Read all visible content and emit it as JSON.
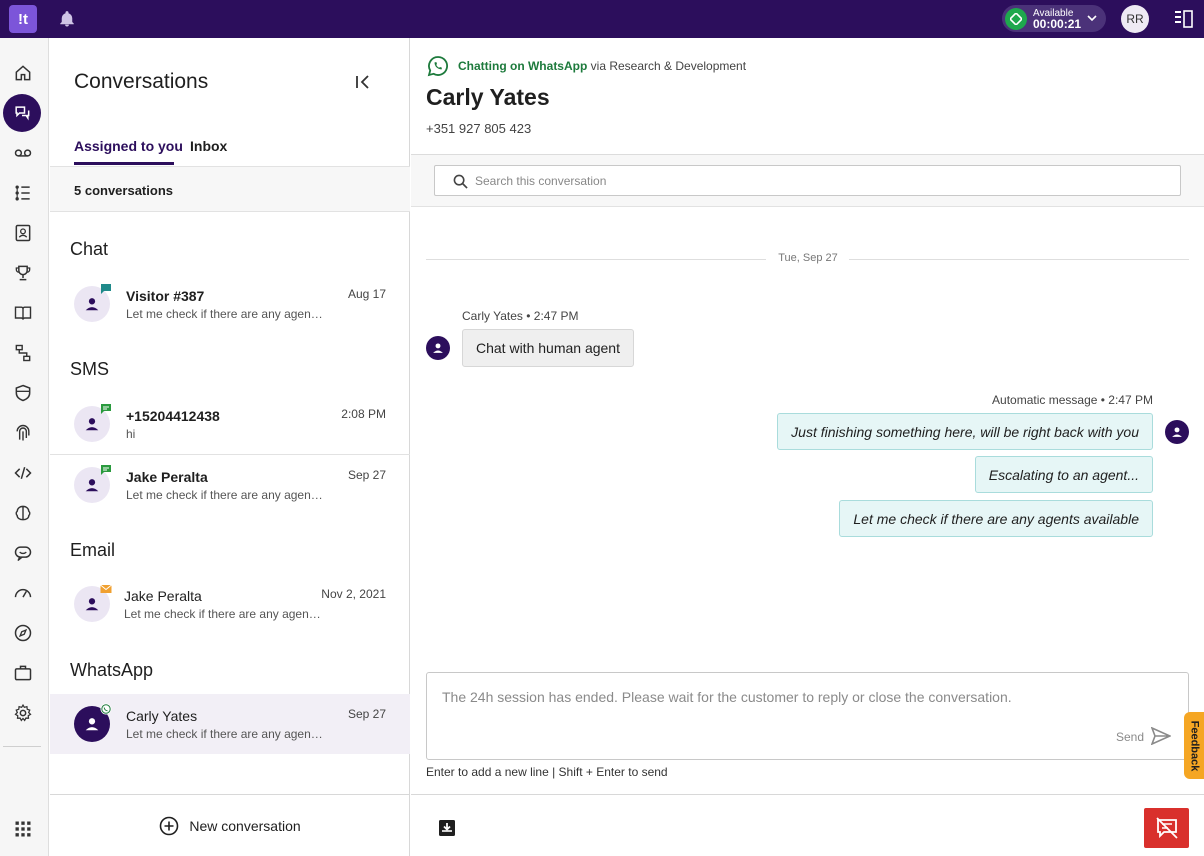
{
  "topbar": {
    "logo_text": "!t",
    "status_label": "Available",
    "status_time": "00:00:21",
    "avatar_initials": "RR"
  },
  "conversations": {
    "title": "Conversations",
    "tabs": [
      {
        "label": "Assigned to you"
      },
      {
        "label": "Inbox"
      }
    ],
    "count_text": "5 conversations",
    "sections": [
      {
        "title": "Chat",
        "items": [
          {
            "name": "Visitor #387",
            "preview": "Let me check if there are any agents available",
            "date": "Aug 17",
            "channel": "chat"
          }
        ]
      },
      {
        "title": "SMS",
        "items": [
          {
            "name": "+15204412438",
            "preview": "hi",
            "date": "2:08 PM",
            "channel": "sms"
          },
          {
            "name": "Jake Peralta",
            "preview": "Let me check if there are any agents available",
            "date": "Sep 27",
            "channel": "sms"
          }
        ]
      },
      {
        "title": "Email",
        "items": [
          {
            "name": "Jake Peralta",
            "preview": "Let me check if there are any agents available",
            "date": "Nov 2, 2021",
            "channel": "email"
          }
        ]
      },
      {
        "title": "WhatsApp",
        "items": [
          {
            "name": "Carly Yates",
            "preview": "Let me check if there are any agents available",
            "date": "Sep 27",
            "channel": "whatsapp",
            "selected": true
          }
        ]
      }
    ],
    "new_conversation_label": "New conversation"
  },
  "chat": {
    "channel_strong": "Chatting on WhatsApp",
    "channel_rest": " via Research & Development",
    "contact_name": "Carly Yates",
    "contact_phone": "+351 927 805 423",
    "search_placeholder": "Search this conversation",
    "date_separator": "Tue, Sep 27",
    "incoming_meta": "Carly Yates • 2:47 PM",
    "incoming_message": "Chat with human agent",
    "outgoing_meta": "Automatic message • 2:47 PM",
    "outgoing_messages": [
      "Just finishing something here, will be right back with you",
      "Escalating to an agent...",
      "Let me check if there are any agents available"
    ],
    "composer_text": "The 24h session has ended. Please wait for the customer to reply or close the conversation.",
    "send_label": "Send",
    "composer_hint": "Enter to add a new line | Shift + Enter to send"
  },
  "feedback_label": "Feedback",
  "colors": {
    "topbar": "#2c0e5c",
    "accent": "#2c0e5c",
    "status_green": "#1ea84d",
    "whatsapp_green": "#1d7a3c",
    "close_red": "#d9302c",
    "feedback_orange": "#f5a623"
  }
}
